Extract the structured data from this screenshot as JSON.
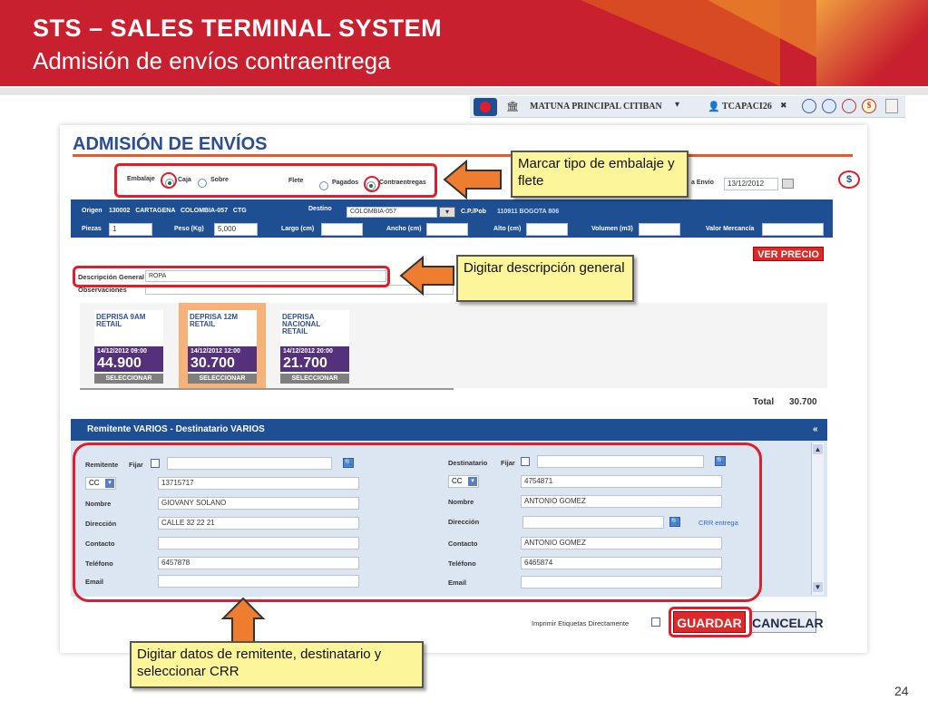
{
  "slide": {
    "title": "STS – SALES  TERMINAL SYSTEM",
    "subtitle": "Admisión de envíos contraentrega",
    "page_number": "24"
  },
  "topbar": {
    "branch": "MATUNA PRINCIPAL CITIBAN",
    "user": "TCAPACI26",
    "close": "✖"
  },
  "app": {
    "heading": "ADMISIÓN DE ENVÍOS",
    "embalaje_label": "Embalaje",
    "embalaje_options": [
      "Caja",
      "Sobre"
    ],
    "flete_label": "Flete",
    "flete_options": [
      "Pagados",
      "Contraentregas"
    ],
    "fecha_label": "a Envío",
    "fecha_value": "13/12/2012",
    "dollar_icon": "$",
    "origen_label": "Origen",
    "origen_value": "130002   CARTAGENA   COLOMBIA-057   CTG",
    "destino_label": "Destino",
    "destino_value": "COLOMBIA-057",
    "cppob_label": "C.P./Pob",
    "cppob_value": "110911 BOGOTA  806",
    "piezas_label": "Piezas",
    "piezas_value": "1",
    "peso_label": "Peso (Kg)",
    "peso_value": "5,000",
    "largo_label": "Largo (cm)",
    "ancho_label": "Ancho (cm)",
    "alto_label": "Alto (cm)",
    "volumen_label": "Volumen (m3)",
    "valor_label": "Valor Mercancía",
    "ver_precio": "VER PRECIO",
    "descripcion_label": "Descripción General",
    "descripcion_value": "ROPA",
    "observaciones_label": "Observaciones",
    "products": [
      {
        "name": "DEPRISA 9AM RETAIL",
        "date": "14/12/2012 09:00",
        "price": "44.900",
        "select": "SELECCIONAR"
      },
      {
        "name": "DEPRISA 12M RETAIL",
        "date": "14/12/2012 12:00",
        "price": "30.700",
        "select": "SELECCIONAR"
      },
      {
        "name": "DEPRISA NACIONAL RETAIL",
        "date": "14/12/2012 20:00",
        "price": "21.700",
        "select": "SELECCIONAR"
      }
    ],
    "total_label": "Total",
    "total_value": "30.700",
    "panel_title": "Remitente VARIOS - Destinatario VARIOS",
    "remitente": {
      "title": "Remitente",
      "fijar": "Fijar",
      "doc_type": "CC",
      "doc_number": "13715717",
      "nombre_label": "Nombre",
      "nombre": "GIOVANY SOLANO",
      "direccion_label": "Dirección",
      "direccion": "CALLE 32 22 21",
      "contacto_label": "Contacto",
      "contacto": "",
      "telefono_label": "Teléfono",
      "telefono": "6457878",
      "email_label": "Email",
      "email": ""
    },
    "destinatario": {
      "title": "Destinatario",
      "fijar": "Fijar",
      "doc_type": "CC",
      "doc_number": "4754871",
      "nombre_label": "Nombre",
      "nombre": "ANTONIO GOMEZ",
      "direccion_label": "Dirección",
      "direccion": "",
      "crr_link": "CRR entrega",
      "contacto_label": "Contacto",
      "contacto": "ANTONIO GOMEZ",
      "telefono_label": "Teléfono",
      "telefono": "6465874",
      "email_label": "Email",
      "email": ""
    },
    "imprimir_label": "Imprimir Etiquetas Directamente",
    "guardar": "GUARDAR",
    "cancelar": "CANCELAR"
  },
  "callouts": {
    "c1": "Marcar tipo de embalaje y flete",
    "c2": "Digitar descripción general",
    "c3": "Digitar datos de remitente, destinatario y seleccionar CRR"
  },
  "colors": {
    "brand_red": "#c8202e",
    "app_blue": "#1e4f93",
    "highlight_red": "#e11d2b",
    "callout_yellow": "#fdf59a",
    "arrow_orange": "#ee7d2f"
  }
}
